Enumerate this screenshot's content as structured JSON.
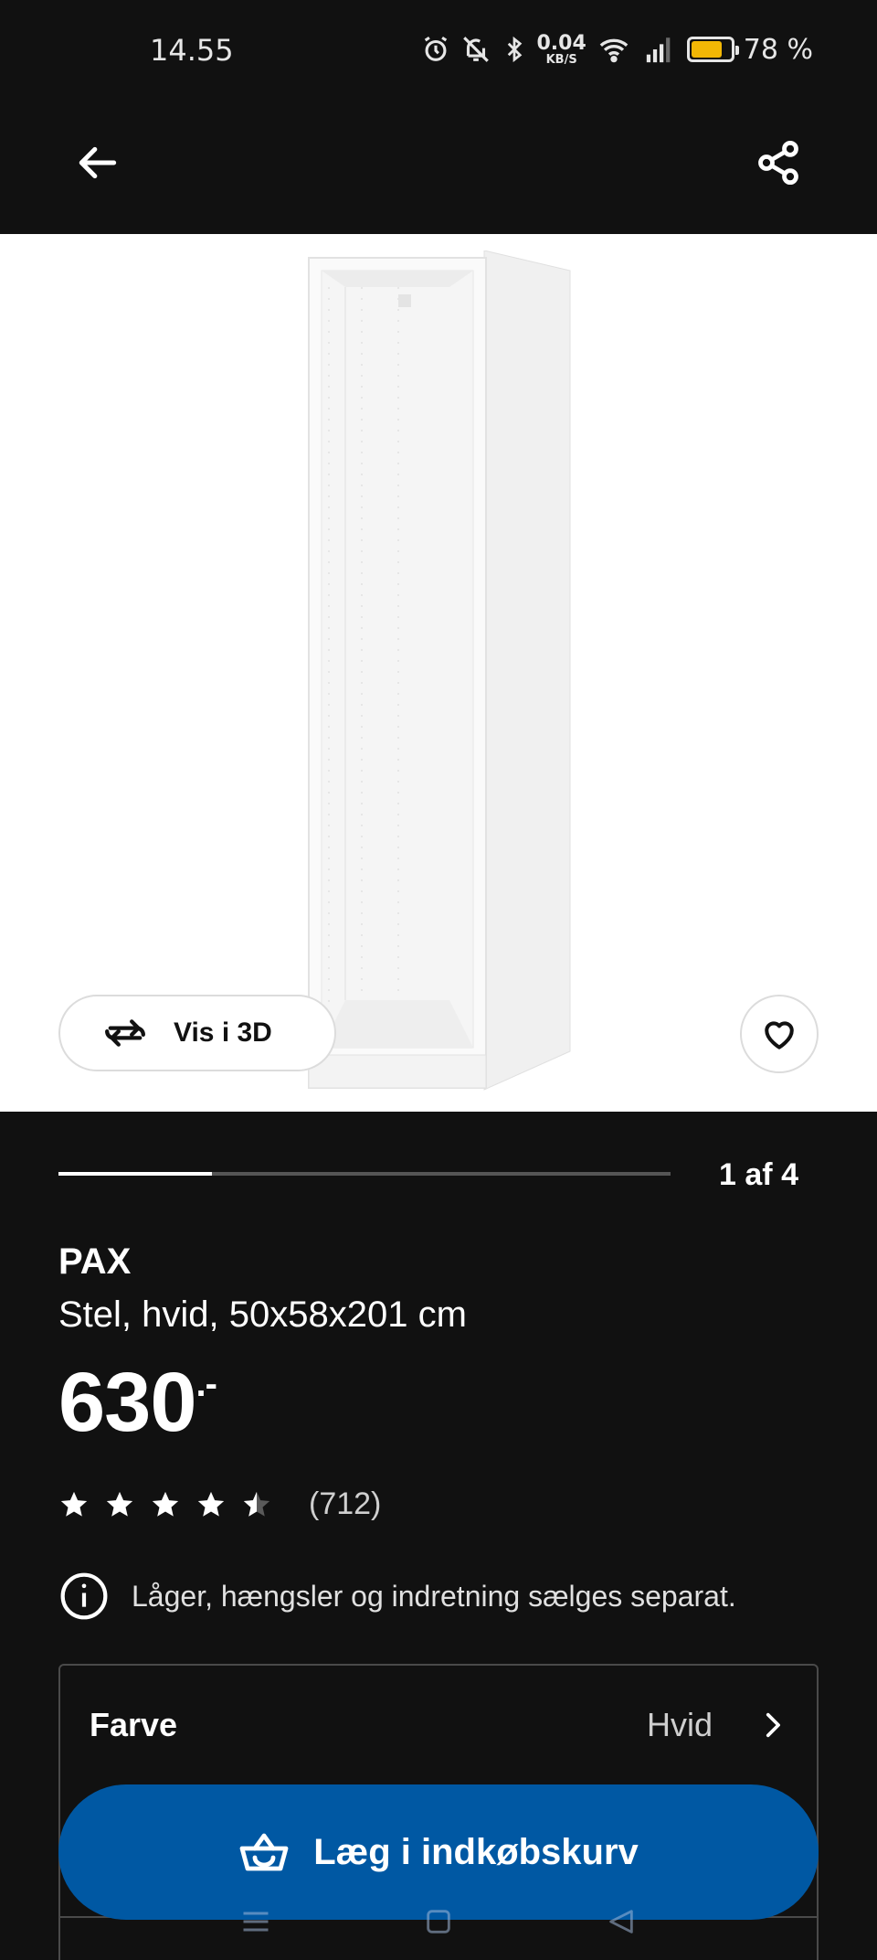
{
  "status_bar": {
    "time": "14.55",
    "net_speed_value": "0.04",
    "net_speed_unit": "KB/S",
    "battery_percent": "78 %",
    "battery_level": 0.78
  },
  "gallery": {
    "view_3d_label": "Vis i 3D",
    "page_counter": "1 af 4",
    "current_image": 1,
    "total_images": 4
  },
  "product": {
    "name": "PAX",
    "description": "Stel, hvid, 50x58x201 cm",
    "price": "630",
    "price_suffix": ".-",
    "rating": 4.5,
    "review_count": "(712)",
    "info_note": "Låger, hængsler og indretning sælges separat."
  },
  "variant": {
    "label": "Farve",
    "value": "Hvid"
  },
  "cart": {
    "label": "Læg i indkøbskurv"
  },
  "colors": {
    "background": "#111111",
    "accent_blue": "#0058a3",
    "battery_yellow": "#f2b705"
  }
}
